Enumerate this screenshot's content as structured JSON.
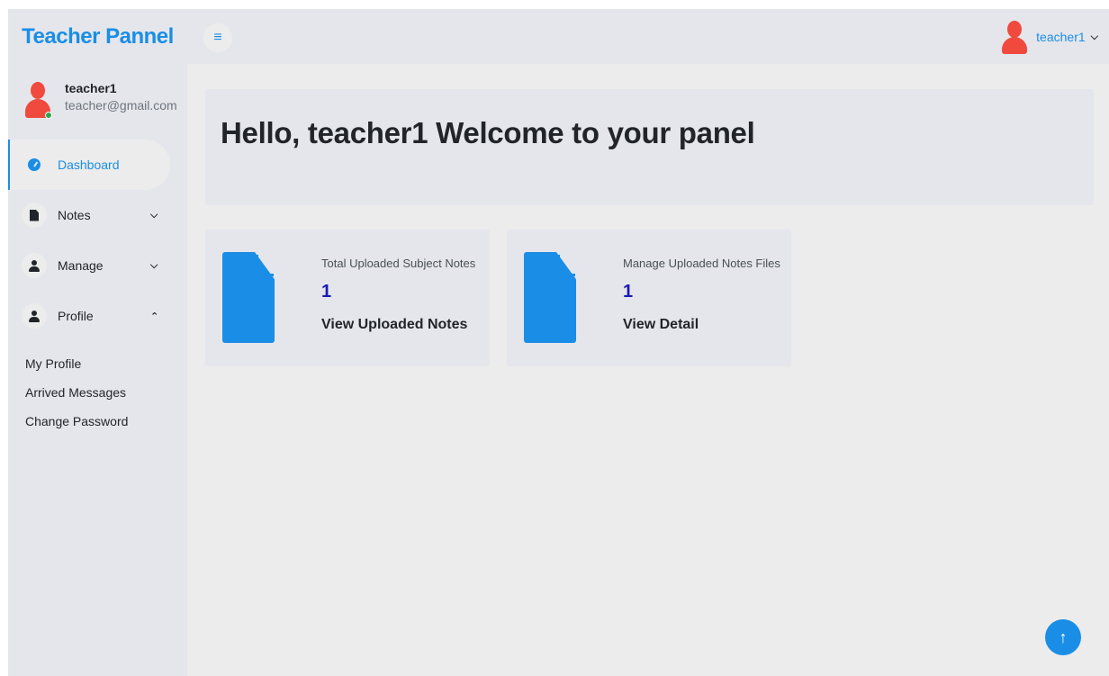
{
  "app": {
    "brand": "Teacher Pannel"
  },
  "sidebar": {
    "user": {
      "name": "teacher1",
      "email": "teacher@gmail.com"
    },
    "items": [
      {
        "label": "Dashboard",
        "icon": "dashboard-icon",
        "active": true
      },
      {
        "label": "Notes",
        "icon": "file-icon",
        "chevron": "chevron-down"
      },
      {
        "label": "Manage",
        "icon": "user-icon",
        "chevron": "chevron-down"
      },
      {
        "label": "Profile",
        "icon": "user-icon",
        "chevron": "chevron-up"
      }
    ],
    "profile_submenu": [
      "My Profile",
      "Arrived Messages",
      "Change Password"
    ]
  },
  "header": {
    "menu_toggle_icon": "hamburger-icon",
    "user_name": "teacher1"
  },
  "main": {
    "welcome": "Hello, teacher1 Welcome to your panel",
    "cards": [
      {
        "caption": "Total Uploaded Subject Notes",
        "count": "1",
        "link": "View Uploaded Notes"
      },
      {
        "caption": "Manage Uploaded Notes Files",
        "count": "1",
        "link": "View Detail"
      }
    ]
  },
  "colors": {
    "accent": "#1a8ee6",
    "avatar": "#f04a3e",
    "count": "#1a1ab3",
    "online": "#2fa34a"
  }
}
